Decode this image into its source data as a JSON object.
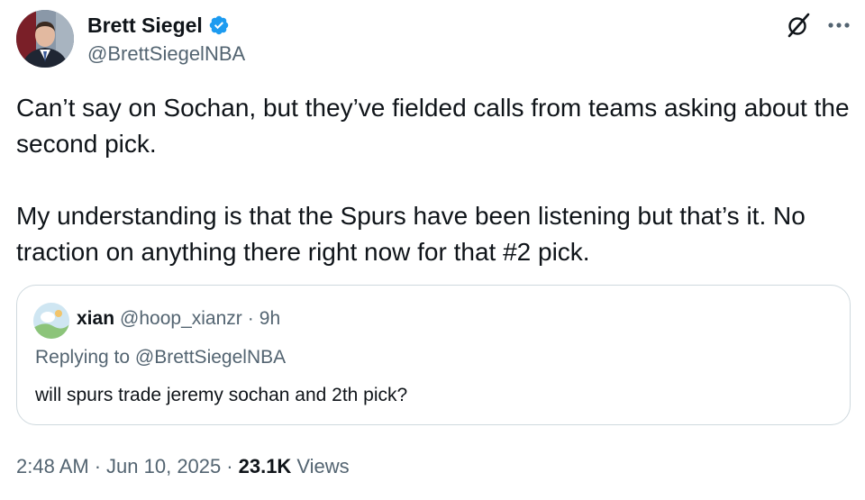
{
  "author": {
    "display_name": "Brett Siegel",
    "handle": "@BrettSiegelNBA",
    "verified_icon": "verified-badge-icon",
    "verified_color": "#1d9bf0"
  },
  "actions": {
    "grok_icon": "grok-icon",
    "more_icon": "more-horizontal-icon"
  },
  "tweet": {
    "paragraphs": [
      "Can’t say on Sochan, but they’ve fielded calls from teams asking about the second pick.",
      "My understanding is that the Spurs have been listening but that’s it. No traction on anything there right now for that #2 pick."
    ]
  },
  "quote": {
    "display_name": "xian",
    "handle": "@hoop_xianzr",
    "separator": "·",
    "age": "9h",
    "replying_to": "Replying to @BrettSiegelNBA",
    "text": "will spurs trade jeremy sochan and 2th pick?"
  },
  "meta": {
    "time": "2:48 AM",
    "dot1": "·",
    "date": "Jun 10, 2025",
    "dot2": "·",
    "views_count": "23.1K",
    "views_label": "Views"
  },
  "colors": {
    "text_primary": "#0f1419",
    "text_secondary": "#536471",
    "border": "#cfd9de",
    "accent": "#1d9bf0"
  }
}
